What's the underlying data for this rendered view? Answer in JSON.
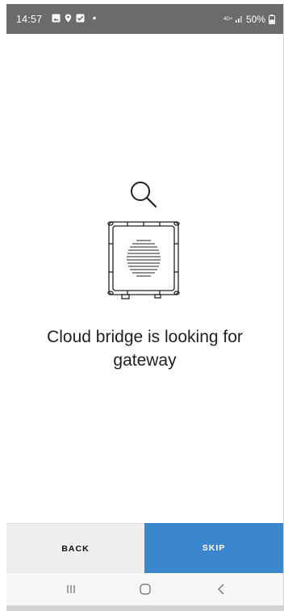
{
  "status_bar": {
    "time": "14:57",
    "network": "4G+",
    "battery": "50%",
    "icons": [
      "image-icon",
      "location-icon",
      "checkbox-icon",
      "dot-icon",
      "signal-icon",
      "battery-icon"
    ]
  },
  "main": {
    "illustration": {
      "icons": [
        "search-icon",
        "gateway-device-icon"
      ]
    },
    "message": "Cloud bridge is looking for gateway"
  },
  "buttons": {
    "back_label": "BACK",
    "skip_label": "SKIP"
  },
  "nav": {
    "icons": [
      "recent-apps-icon",
      "home-icon",
      "back-icon"
    ]
  },
  "colors": {
    "status_bar_bg": "#6b6b6b",
    "back_button_bg": "#eeeef0",
    "skip_button_bg": "#3b86cd"
  }
}
